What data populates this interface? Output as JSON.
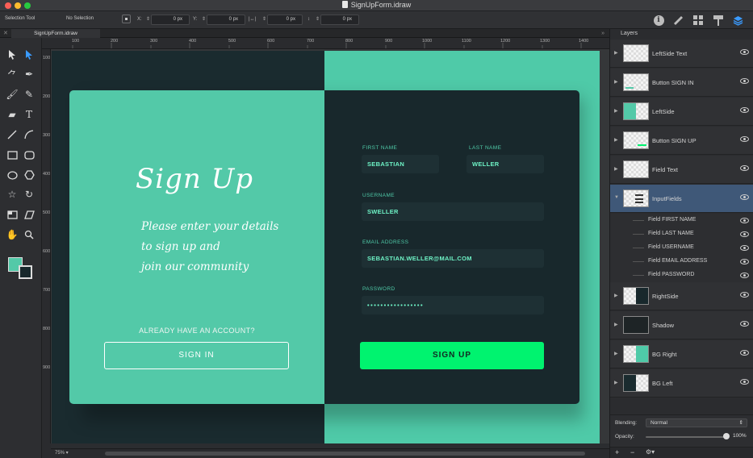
{
  "window": {
    "title": "SignUpForm.idraw"
  },
  "toolbar": {
    "tool_name": "Selection Tool",
    "selection": "No Selection",
    "x_label": "X:",
    "x_value": "0 px",
    "y_label": "Y:",
    "y_value": "0 px",
    "w_label": "|↔|",
    "w_value": "0 px",
    "h_label": "↕",
    "h_value": "0 px"
  },
  "tab": {
    "label": "SignUpForm.idraw"
  },
  "ruler": {
    "h_ticks": [
      "100",
      "200",
      "300",
      "400",
      "500",
      "600",
      "700",
      "800",
      "900",
      "1000",
      "1100",
      "1200",
      "1300",
      "1400"
    ],
    "v_ticks": [
      "100",
      "200",
      "300",
      "400",
      "500",
      "600",
      "700",
      "800",
      "900"
    ]
  },
  "design": {
    "colors": {
      "left_green": "#53c9a8",
      "dark": "#18282c",
      "accent": "#00f36f",
      "field_text": "#6ef3c6"
    },
    "left": {
      "title": "Sign Up",
      "subtitle_lines": [
        "Please enter your details",
        "to sign up and",
        "join our community"
      ],
      "already": "ALREADY HAVE AN ACCOUNT?",
      "signin": "SIGN IN"
    },
    "form": {
      "first_name_label": "FIRST NAME",
      "first_name_value": "SEBASTIAN",
      "last_name_label": "LAST NAME",
      "last_name_value": "WELLER",
      "username_label": "USERNAME",
      "username_value": "SWELLER",
      "email_label": "EMAIL ADDRESS",
      "email_value": "SEBASTIAN.WELLER@MAIL.COM",
      "password_label": "PASSWORD",
      "password_value": "•••••••••••••••••",
      "signup": "SIGN UP"
    }
  },
  "status": {
    "zoom": "75%"
  },
  "layers": {
    "title": "Layers",
    "items": [
      {
        "name": "LeftSide Text"
      },
      {
        "name": "Button SIGN IN"
      },
      {
        "name": "LeftSide"
      },
      {
        "name": "Button SIGN UP"
      },
      {
        "name": "Field Text"
      },
      {
        "name": "InputFields"
      },
      {
        "name": "RightSide"
      },
      {
        "name": "Shadow"
      },
      {
        "name": "BG Right"
      },
      {
        "name": "BG Left"
      }
    ],
    "sub_items": [
      "Field FIRST NAME",
      "Field LAST NAME",
      "Field USERNAME",
      "Field EMAIL ADDRESS",
      "Field PASSWORD"
    ],
    "blending_label": "Blending:",
    "blending_value": "Normal",
    "opacity_label": "Opacity:",
    "opacity_value": "100%",
    "add": "+",
    "remove": "−",
    "gear": "⚙▾"
  }
}
